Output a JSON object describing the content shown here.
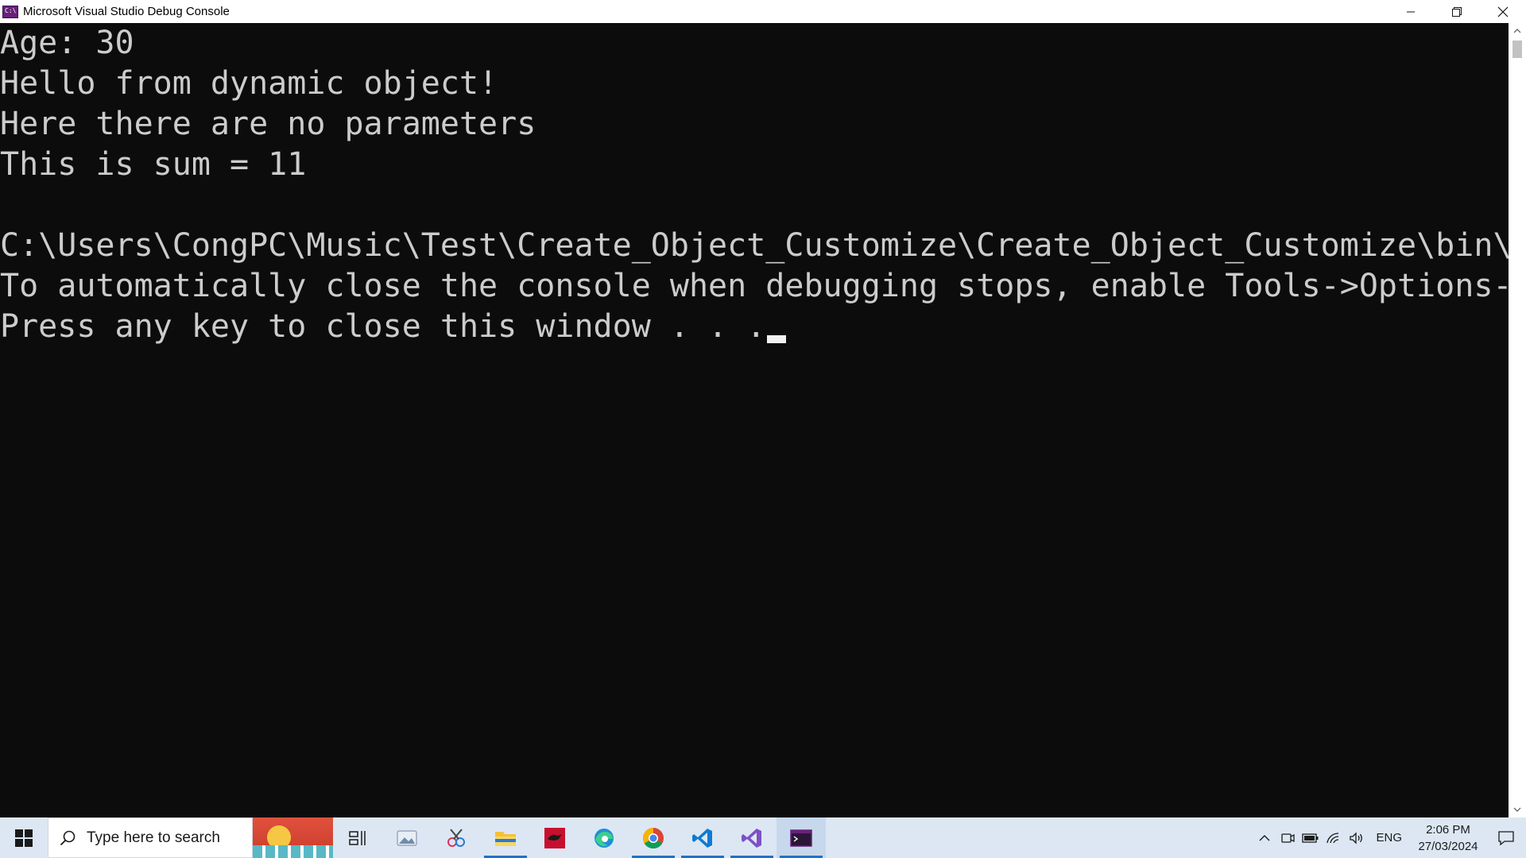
{
  "window": {
    "title": "Microsoft Visual Studio Debug Console"
  },
  "console": {
    "lines": [
      "Age: 30",
      "Hello from dynamic object!",
      "Here there are no parameters",
      "This is sum = 11",
      "",
      "C:\\Users\\CongPC\\Music\\Test\\Create_Object_Customize\\Create_Object_Customize\\bin\\",
      "To automatically close the console when debugging stops, enable Tools->Options-",
      "Press any key to close this window . . ."
    ],
    "colors": {
      "background": "#0c0c0c",
      "text": "#cccccc"
    }
  },
  "taskbar": {
    "search_placeholder": "Type here to search",
    "apps": [
      {
        "name": "task-view",
        "active": false
      },
      {
        "name": "photos",
        "active": false
      },
      {
        "name": "snipping-tool",
        "active": false
      },
      {
        "name": "file-explorer",
        "active": true
      },
      {
        "name": "media-app",
        "active": false
      },
      {
        "name": "edge",
        "active": false
      },
      {
        "name": "chrome",
        "active": true
      },
      {
        "name": "vscode",
        "active": true
      },
      {
        "name": "visual-studio",
        "active": true
      },
      {
        "name": "debug-console",
        "active": true
      }
    ],
    "tray": {
      "language": "ENG",
      "time": "2:06 PM",
      "date": "27/03/2024"
    }
  }
}
